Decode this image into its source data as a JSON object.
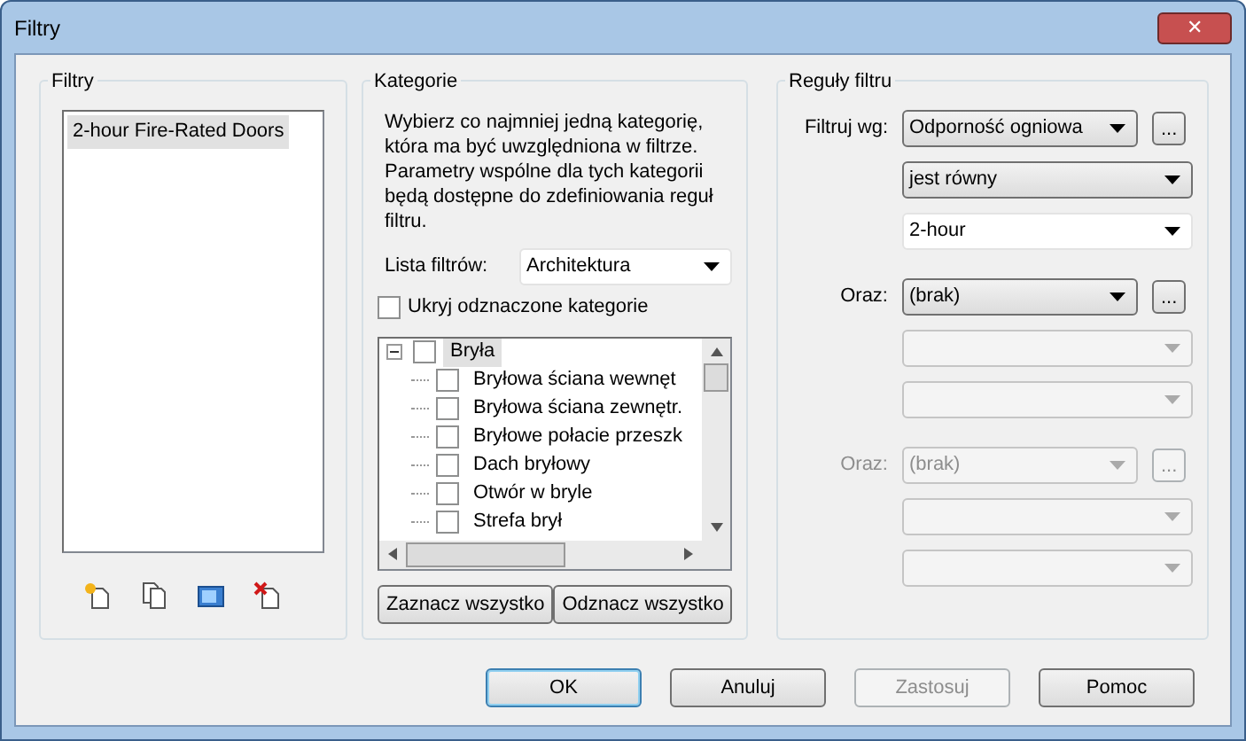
{
  "window": {
    "title": "Filtry",
    "close_label": "✕"
  },
  "filters": {
    "title": "Filtry",
    "items": [
      {
        "label": "2-hour Fire-Rated Doors",
        "selected": true
      }
    ]
  },
  "categories": {
    "title": "Kategorie",
    "description": "Wybierz co najmniej jedną kategorię, która ma być uwzględniona w filtrze. Parametry wspólne dla tych kategorii będą dostępne do zdefiniowania reguł filtru.",
    "list_label": "Lista filtrów:",
    "list_value": "Architektura",
    "hide_label": "Ukryj odznaczone kategorie",
    "hide_checked": false,
    "tree": [
      {
        "label": "Bryła",
        "checked": false,
        "expanded": true,
        "selected": true,
        "children": [
          {
            "label": "Bryłowa ściana wewnęt",
            "checked": false,
            "selected": false
          },
          {
            "label": "Bryłowa ściana zewnętr.",
            "checked": false,
            "selected": false
          },
          {
            "label": "Bryłowe połacie przeszk",
            "checked": false,
            "selected": false
          },
          {
            "label": "Dach bryłowy",
            "checked": false,
            "selected": false
          },
          {
            "label": "Otwór w bryle",
            "checked": false,
            "selected": false
          },
          {
            "label": "Strefa brył",
            "checked": false,
            "selected": false
          }
        ]
      }
    ],
    "buttons": [
      "Zaznacz wszystko",
      "Odznacz wszystko"
    ]
  },
  "rules": {
    "title": "Reguły filtru",
    "groups": [
      {
        "label": "Filtruj wg:",
        "disabled": false,
        "more": "...",
        "fields": [
          {
            "kind": "combo",
            "value": "Odporność ogniowa",
            "disabled": false
          },
          {
            "kind": "combo",
            "value": "jest równy",
            "disabled": false
          },
          {
            "kind": "edit",
            "value": "2-hour",
            "disabled": false
          }
        ]
      },
      {
        "label": "Oraz:",
        "disabled": false,
        "more": "...",
        "fields": [
          {
            "kind": "combo",
            "value": "(brak)",
            "disabled": false
          },
          {
            "kind": "combo",
            "disabled": true
          },
          {
            "kind": "edit",
            "disabled": true
          }
        ]
      },
      {
        "label": "Oraz:",
        "disabled": true,
        "more": "...",
        "fields": [
          {
            "kind": "combo",
            "value": "(brak)",
            "disabled": true
          },
          {
            "kind": "combo",
            "disabled": true
          },
          {
            "kind": "edit",
            "disabled": true
          }
        ]
      }
    ]
  },
  "buttons": [
    {
      "label": "OK",
      "disabled": false,
      "default": true
    },
    {
      "label": "Anuluj",
      "disabled": false,
      "default": false
    },
    {
      "label": "Zastosuj",
      "disabled": true,
      "default": false
    },
    {
      "label": "Pomoc",
      "disabled": false,
      "default": false
    }
  ]
}
